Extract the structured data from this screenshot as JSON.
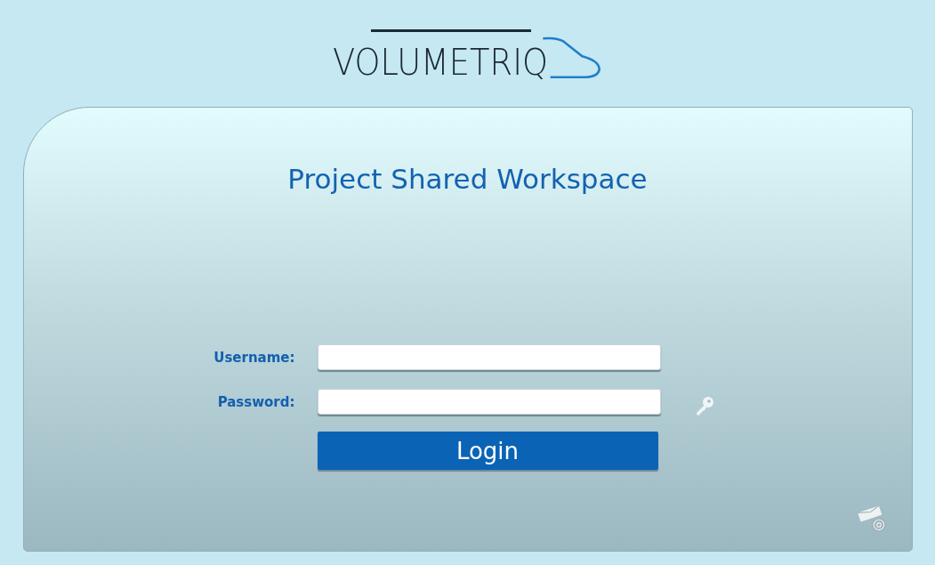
{
  "logo": {
    "text": "VOLUMETRIQ"
  },
  "title": "Project Shared Workspace",
  "fields": [
    {
      "label": "Username:",
      "key_icon": false
    },
    {
      "label": "Password:",
      "key_icon": true
    }
  ],
  "login_button": "Login"
}
